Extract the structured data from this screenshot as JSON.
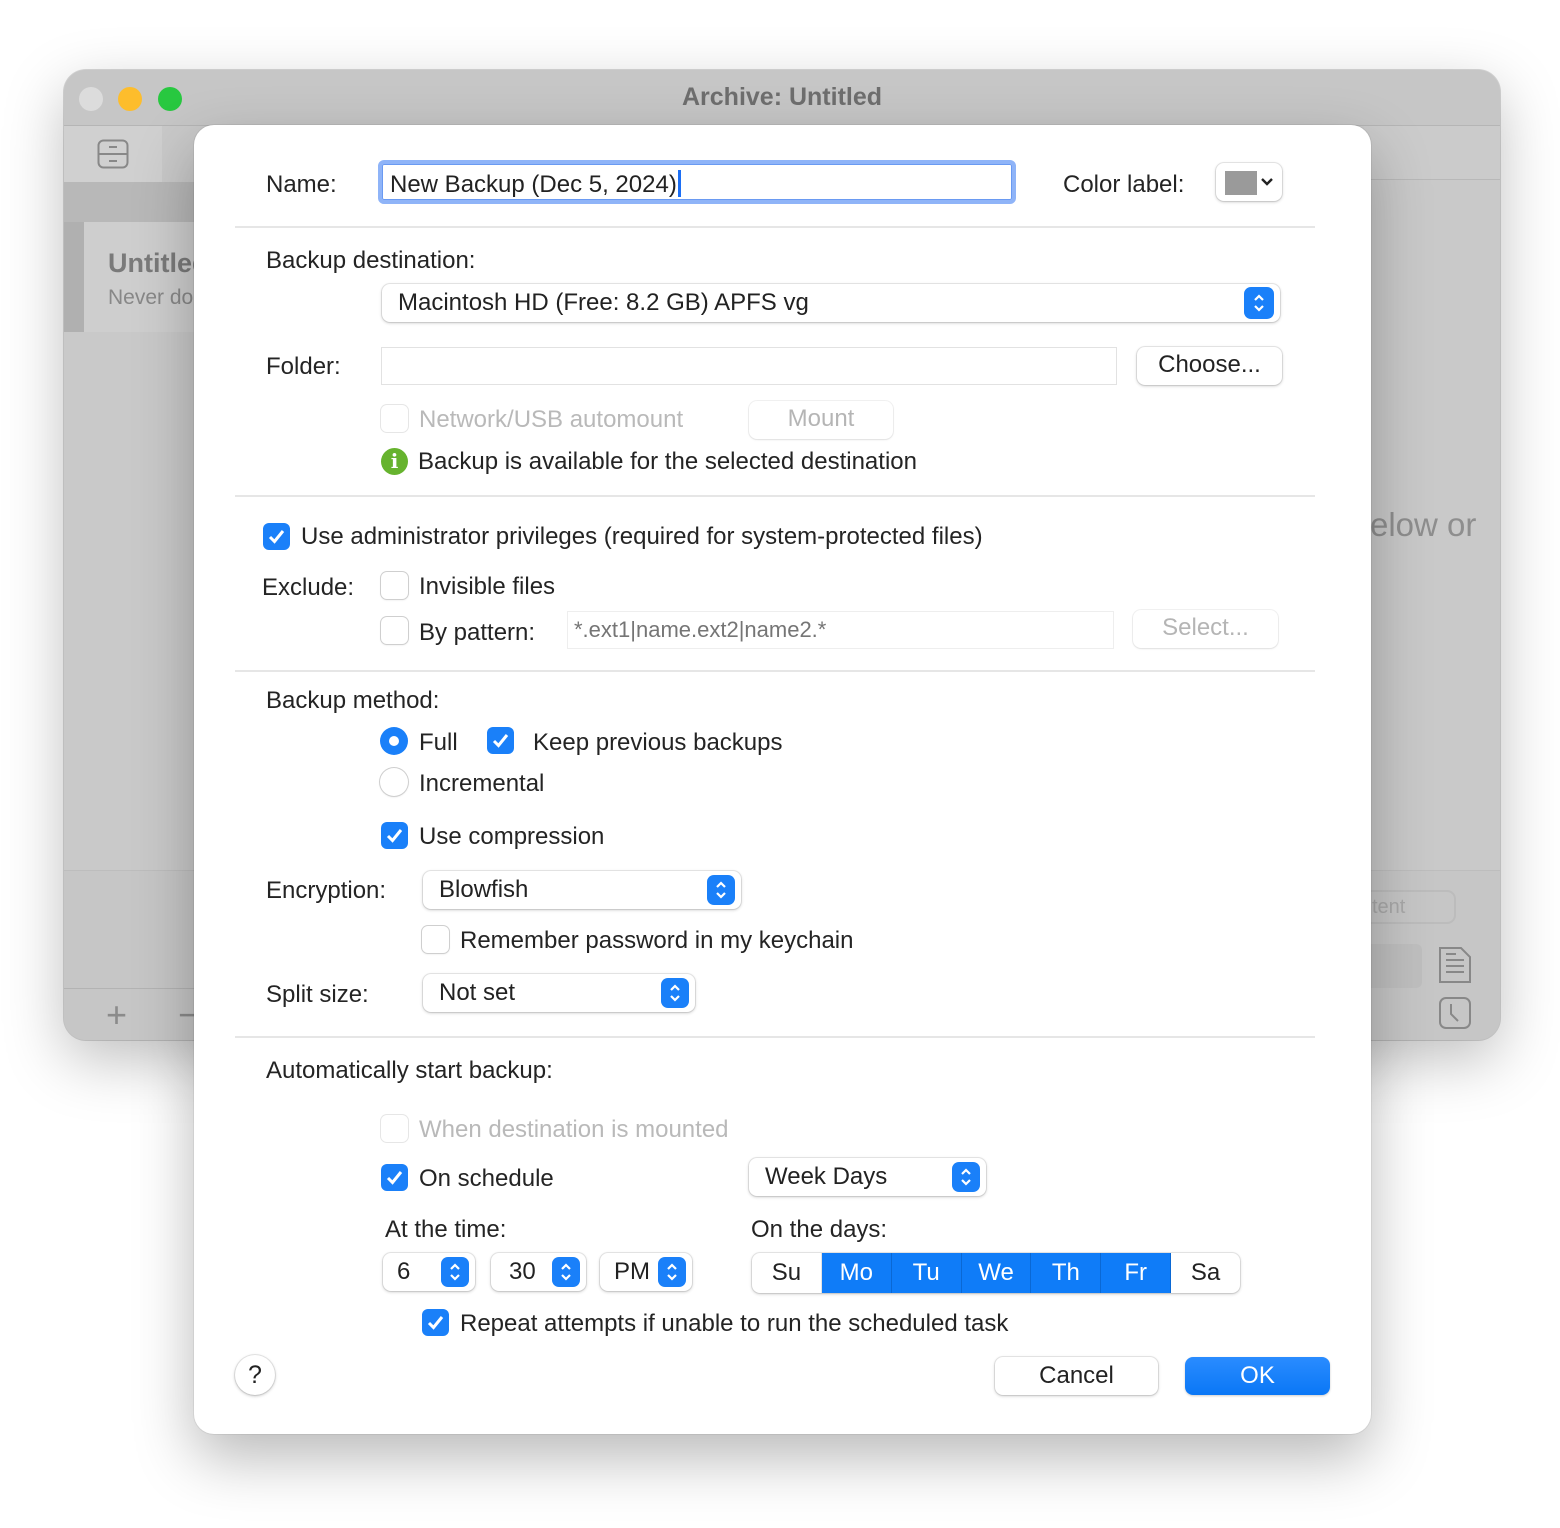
{
  "window": {
    "title": "Archive: Untitled",
    "sidebar_item_title": "Untitled",
    "sidebar_item_subtitle": "Never done",
    "background_hint": "elow or",
    "background_button": "tent",
    "add_label": "+",
    "remove_label": "−"
  },
  "dialog": {
    "name_label": "Name:",
    "name_value": "New Backup (Dec 5, 2024)",
    "color_label": "Color label:",
    "color_value": "#9a9a9a",
    "destination_label": "Backup destination:",
    "destination_value": "Macintosh HD (Free: 8.2 GB) APFS vg",
    "folder_label": "Folder:",
    "folder_value": "",
    "choose_button": "Choose...",
    "automount_label": "Network/USB automount",
    "automount_checked": false,
    "mount_button": "Mount",
    "status_message": "Backup is available for the selected destination",
    "admin_label": "Use administrator privileges (required for system-protected files)",
    "admin_checked": true,
    "exclude_label": "Exclude:",
    "invisible_label": "Invisible files",
    "invisible_checked": false,
    "pattern_label": "By pattern:",
    "pattern_checked": false,
    "pattern_placeholder": "*.ext1|name.ext2|name2.*",
    "select_button": "Select...",
    "method_label": "Backup method:",
    "method_full": "Full",
    "method_incremental": "Incremental",
    "method_selected": "Full",
    "keep_previous_label": "Keep previous backups",
    "keep_previous_checked": true,
    "compression_label": "Use compression",
    "compression_checked": true,
    "encryption_label": "Encryption:",
    "encryption_value": "Blowfish",
    "remember_password_label": "Remember password in my keychain",
    "remember_password_checked": false,
    "split_label": "Split size:",
    "split_value": "Not set",
    "auto_start_label": "Automatically start backup:",
    "when_mounted_label": "When destination is mounted",
    "when_mounted_checked": false,
    "on_schedule_label": "On schedule",
    "on_schedule_checked": true,
    "schedule_value": "Week Days",
    "at_time_label": "At the time:",
    "hour_value": "6",
    "minute_value": "30",
    "ampm_value": "PM",
    "on_days_label": "On the days:",
    "days": [
      {
        "label": "Su",
        "selected": false
      },
      {
        "label": "Mo",
        "selected": true
      },
      {
        "label": "Tu",
        "selected": true
      },
      {
        "label": "We",
        "selected": true
      },
      {
        "label": "Th",
        "selected": true
      },
      {
        "label": "Fr",
        "selected": true
      },
      {
        "label": "Sa",
        "selected": false
      }
    ],
    "repeat_label": "Repeat attempts if unable to run the scheduled task",
    "repeat_checked": true,
    "help_label": "?",
    "cancel_button": "Cancel",
    "ok_button": "OK"
  },
  "colors": {
    "accent": "#1a80f9",
    "info_green": "#66b32e",
    "focus_ring": "#8fb4f8"
  }
}
